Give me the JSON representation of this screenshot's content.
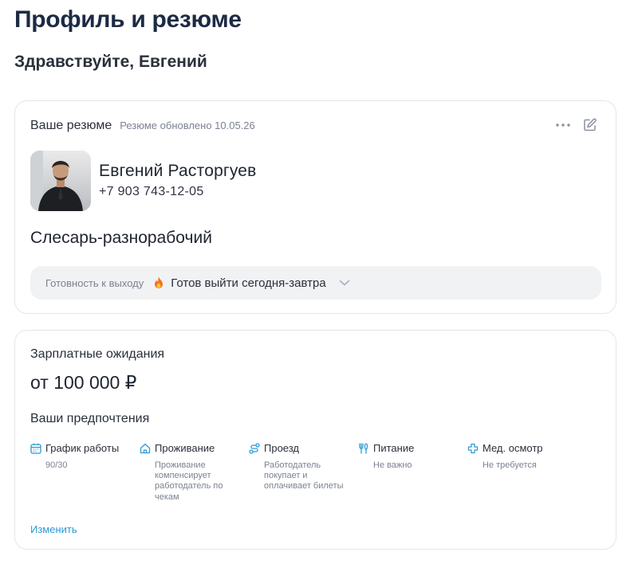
{
  "page": {
    "title": "Профиль и резюме",
    "greeting": "Здравствуйте, Евгений"
  },
  "resume": {
    "title": "Ваше резюме",
    "updated": "Резюме обновлено 10.05.26",
    "name": "Евгений Расторгуев",
    "phone": "+7 903 743-12-05",
    "position": "Слесарь-разнорабочий",
    "readiness_label": "Готовность к выходу",
    "readiness_value": "Готов выйти сегодня-завтра"
  },
  "salary": {
    "label": "Зарплатные ожидания",
    "value": "от 100 000 ₽",
    "preferences_title": "Ваши предпочтения",
    "edit_label": "Изменить",
    "prefs": [
      {
        "label": "График работы",
        "value": "90/30",
        "icon": "calendar-icon"
      },
      {
        "label": "Проживание",
        "value": "Проживание компенсирует работодатель по чекам",
        "icon": "home-icon"
      },
      {
        "label": "Проезд",
        "value": "Работодатель покупает и оплачивает билеты",
        "icon": "route-icon"
      },
      {
        "label": "Питание",
        "value": "Не важно",
        "icon": "cutlery-icon"
      },
      {
        "label": "Мед. осмотр",
        "value": "Не требуется",
        "icon": "medical-cross-icon"
      }
    ]
  },
  "colors": {
    "accent": "#2b9bd6",
    "title": "#1c2a44",
    "muted": "#7b8291"
  }
}
